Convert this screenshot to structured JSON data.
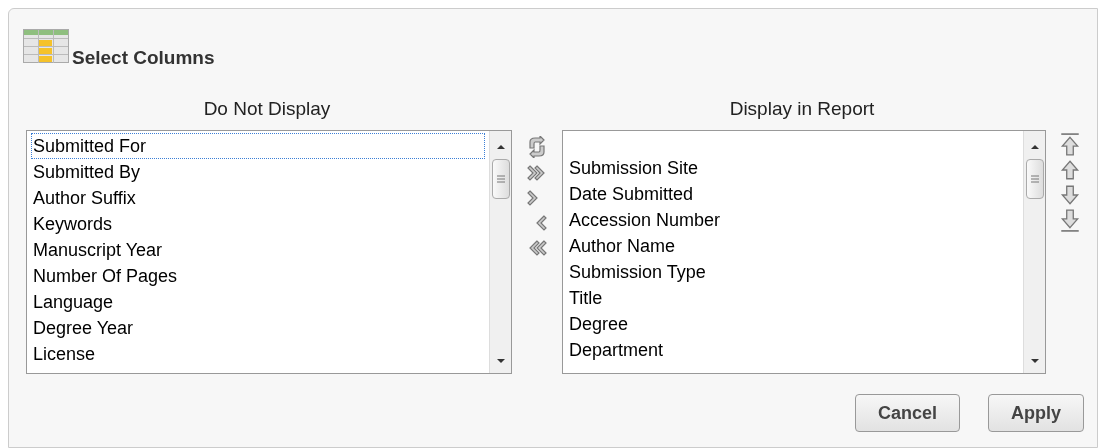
{
  "title": "Select Columns",
  "available": {
    "heading": "Do Not Display",
    "items": [
      {
        "label": "Submitted For",
        "focused": true
      },
      {
        "label": "Submitted By",
        "focused": false
      },
      {
        "label": "Author Suffix",
        "focused": false
      },
      {
        "label": "Keywords",
        "focused": false
      },
      {
        "label": "Manuscript Year",
        "focused": false
      },
      {
        "label": "Number Of Pages",
        "focused": false
      },
      {
        "label": "Language",
        "focused": false
      },
      {
        "label": "Degree Year",
        "focused": false
      },
      {
        "label": "License",
        "focused": false
      }
    ]
  },
  "displayed": {
    "heading": "Display in Report",
    "items": [
      {
        "label": "Submission Site",
        "focused": false
      },
      {
        "label": "Date Submitted",
        "focused": false
      },
      {
        "label": "Accession Number",
        "focused": false
      },
      {
        "label": "Author Name",
        "focused": false
      },
      {
        "label": "Submission Type",
        "focused": false
      },
      {
        "label": "Title",
        "focused": false
      },
      {
        "label": "Degree",
        "focused": false
      },
      {
        "label": "Department",
        "focused": false
      }
    ]
  },
  "buttons": [
    "Cancel",
    "Apply"
  ]
}
